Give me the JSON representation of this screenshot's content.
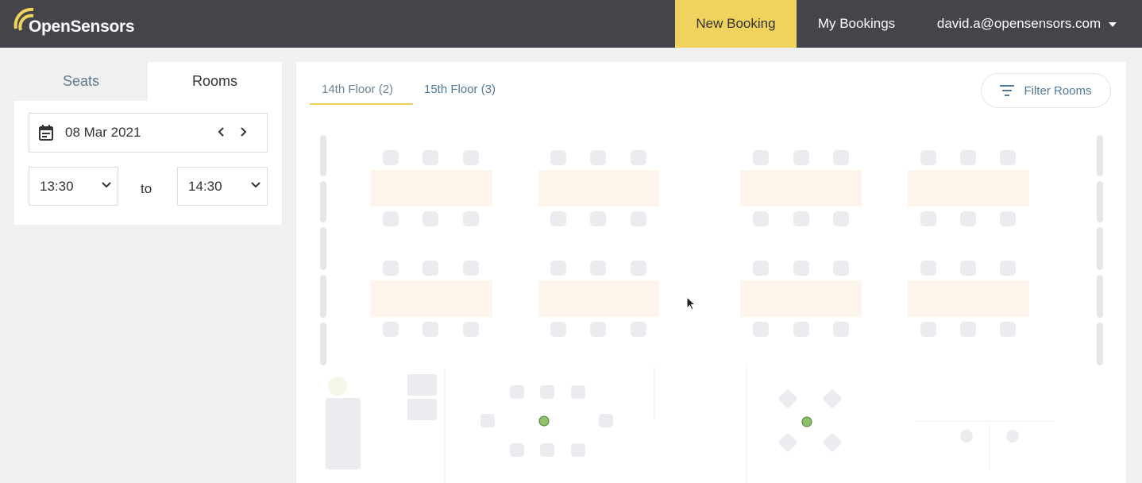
{
  "app": {
    "logo_text": "OpenSensors"
  },
  "nav": {
    "new_booking": "New Booking",
    "my_bookings": "My Bookings",
    "user_email": "david.a@opensensors.com"
  },
  "sidebar": {
    "tabs": [
      {
        "label": "Seats",
        "active": false
      },
      {
        "label": "Rooms",
        "active": true
      }
    ],
    "date": "08 Mar 2021",
    "time_from": "13:30",
    "to_label": "to",
    "time_to": "14:30"
  },
  "floors": {
    "tabs": [
      {
        "label": "14th Floor (2)",
        "active": true
      },
      {
        "label": "15th Floor (3)",
        "active": false
      }
    ],
    "filter_label": "Filter Rooms"
  },
  "colors": {
    "header_bg": "#46444b",
    "accent": "#efd35e",
    "link": "#4d7a98",
    "available_marker": "#8dc26b"
  },
  "icons": {
    "calendar": "calendar-icon",
    "prev": "chevron-left-icon",
    "next": "chevron-right-icon",
    "dropdown": "chevron-down-icon",
    "filter": "filter-icon",
    "user_menu": "caret-down-icon"
  }
}
